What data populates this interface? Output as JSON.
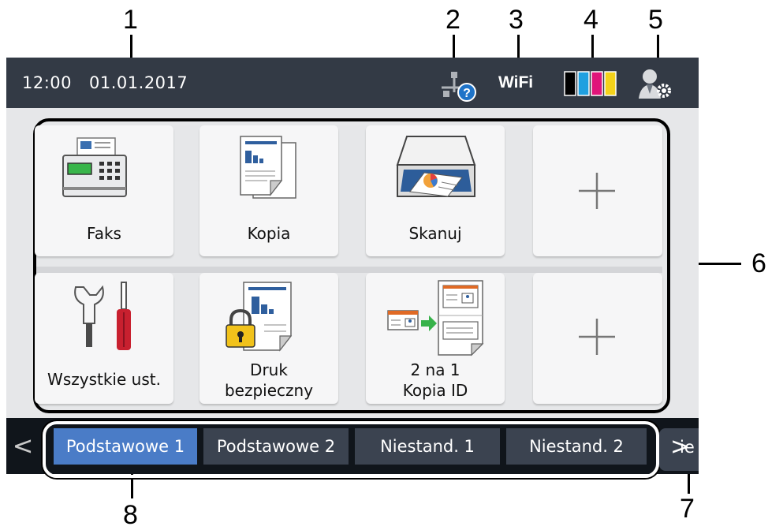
{
  "callouts": [
    "1",
    "2",
    "3",
    "4",
    "5",
    "6",
    "7",
    "8"
  ],
  "status_bar": {
    "time": "12:00",
    "date": "01.01.2017",
    "network_icon": "network-unknown-icon",
    "wifi_label": "WiFi",
    "ink_icon": "ink-levels-icon",
    "ink_colors": [
      "#000000",
      "#1fa0e0",
      "#e0157a",
      "#f4d21a"
    ],
    "admin_icon": "user-settings-icon"
  },
  "shortcuts": [
    {
      "label": "Faks",
      "icon": "fax-icon"
    },
    {
      "label": "Kopia",
      "icon": "copy-icon"
    },
    {
      "label": "Skanuj",
      "icon": "scanner-icon"
    },
    {
      "label": "",
      "icon": "plus-icon"
    },
    {
      "label": "Wszystkie ust.",
      "icon": "tools-icon"
    },
    {
      "label_line1": "Druk",
      "label_line2": "bezpieczny",
      "icon": "secure-print-icon"
    },
    {
      "label_line1": "2 na 1",
      "label_line2": "Kopia ID",
      "icon": "id-copy-icon"
    },
    {
      "label": "",
      "icon": "plus-icon"
    }
  ],
  "tabs": [
    {
      "label": "Podstawowe 1",
      "active": true
    },
    {
      "label": "Podstawowe 2",
      "active": false
    },
    {
      "label": "Niestand. 1",
      "active": false
    },
    {
      "label": "Niestand. 2",
      "active": false
    }
  ],
  "nav": {
    "prev": "<",
    "next": ">",
    "next_partial_text": "ie"
  },
  "colors": {
    "status_bar": "#333a45",
    "screen_bg": "#e6e7e9",
    "tab_active": "#4a7cc7",
    "tab": "#3b4350"
  }
}
